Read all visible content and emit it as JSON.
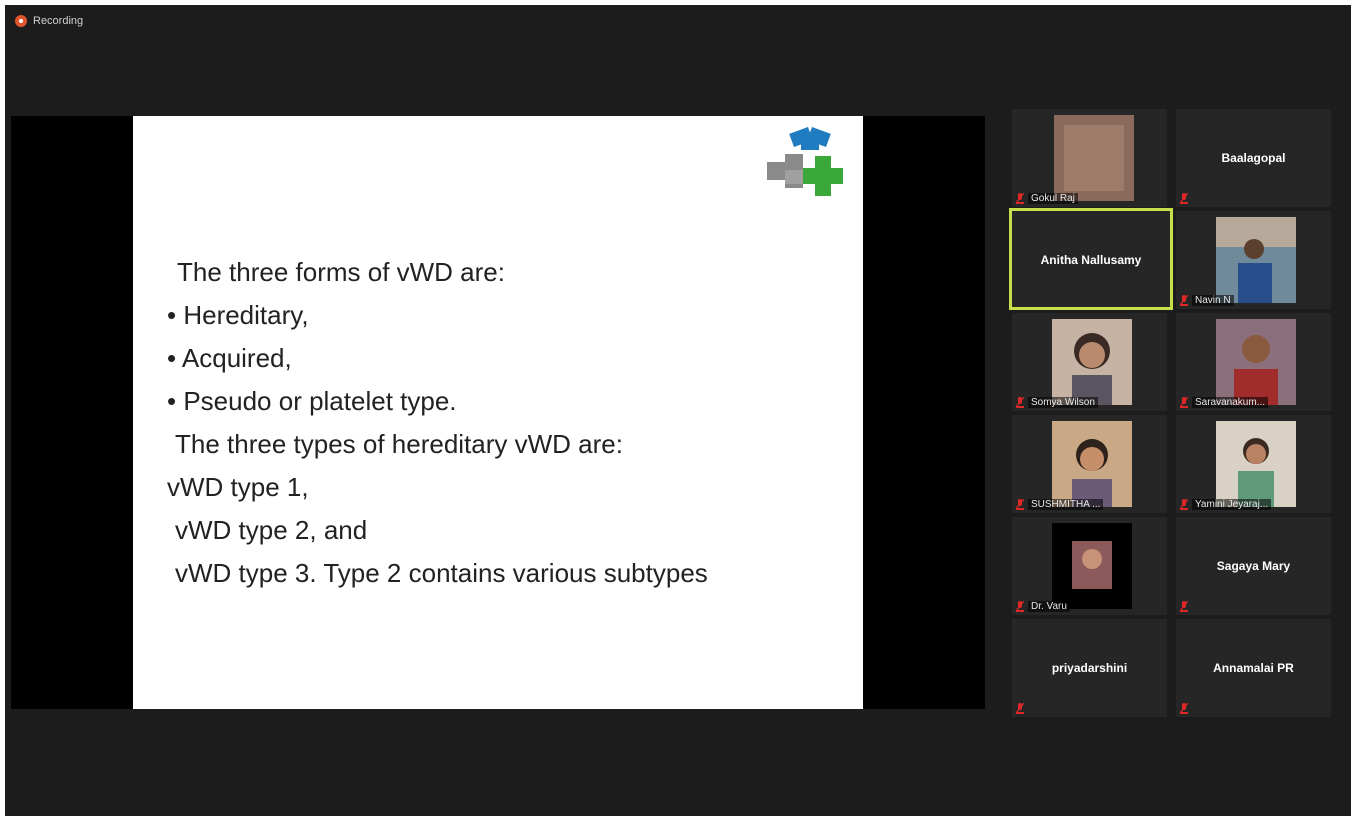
{
  "recording": {
    "label": "Recording"
  },
  "slide": {
    "lines": [
      "The three forms of vWD are:",
      "•  Hereditary,",
      "• Acquired,",
      "• Pseudo or platelet type.",
      "The three types of hereditary vWD are:",
      "vWD type 1,",
      "vWD type 2, and",
      "vWD type 3. Type 2 contains various subtypes"
    ]
  },
  "participants": [
    {
      "name": "Gokul Raj",
      "video": true,
      "muted": true
    },
    {
      "name": "Baalagopal",
      "video": false,
      "muted": true
    },
    {
      "name": "Anitha Nallusamy",
      "video": false,
      "muted": false,
      "active_speaker": true
    },
    {
      "name": "Navin N",
      "video": true,
      "muted": true
    },
    {
      "name": "Somya Wilson",
      "video": true,
      "muted": true
    },
    {
      "name": "Saravanakum...",
      "video": true,
      "muted": true
    },
    {
      "name": "SUSHMITHA ...",
      "video": true,
      "muted": true
    },
    {
      "name": "Yamini Jeyaraj...",
      "video": true,
      "muted": true
    },
    {
      "name": "Dr. Varu",
      "video": true,
      "muted": true
    },
    {
      "name": "Sagaya Mary",
      "video": false,
      "muted": true
    },
    {
      "name": "priyadarshini",
      "video": false,
      "muted": true
    },
    {
      "name": "Annamalai PR",
      "video": false,
      "muted": true
    }
  ],
  "colors": {
    "background": "#1c1c1c",
    "tile": "#262626",
    "active_speaker_border": "#c8de4a",
    "muted_icon": "#e02828",
    "recording_dot": "#e0552b"
  },
  "icons": {
    "muted": "mic-muted-icon",
    "recording": "recording-dot-icon",
    "logo": "slide-logo-icon"
  }
}
